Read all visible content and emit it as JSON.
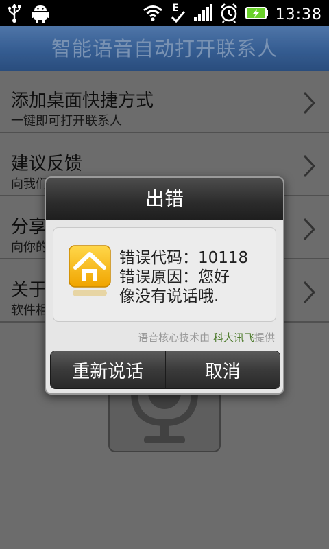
{
  "status_bar": {
    "time": "13:38",
    "icons": [
      "usb-icon",
      "android-icon",
      "wifi-icon",
      "edge-signal-icon",
      "signal-bars-icon",
      "alarm-icon",
      "battery-charging-icon"
    ],
    "network_label": "E"
  },
  "app": {
    "title": "智能语音自动打开联系人"
  },
  "menu": {
    "items": [
      {
        "title": "添加桌面快捷方式",
        "subtitle": "一键即可打开联系人"
      },
      {
        "title": "建议反馈",
        "subtitle": "向我们"
      },
      {
        "title": "分享",
        "subtitle": "向你的"
      },
      {
        "title": "关于",
        "subtitle": "软件相"
      }
    ]
  },
  "dialog": {
    "title": "出错",
    "error_code_label": "错误代码：10118",
    "error_reason_line1": "错误原因：您好",
    "error_reason_line2": "像没有说话哦.",
    "credit_prefix": "语音核心技术由",
    "credit_link": "科大讯飞",
    "credit_suffix": "提供",
    "retry_button": "重新说话",
    "cancel_button": "取消"
  },
  "colors": {
    "title_bar": "#3d6aa6",
    "background": "#7b7b7b",
    "battery": "#6ad12b",
    "link": "#4f7c2e"
  }
}
